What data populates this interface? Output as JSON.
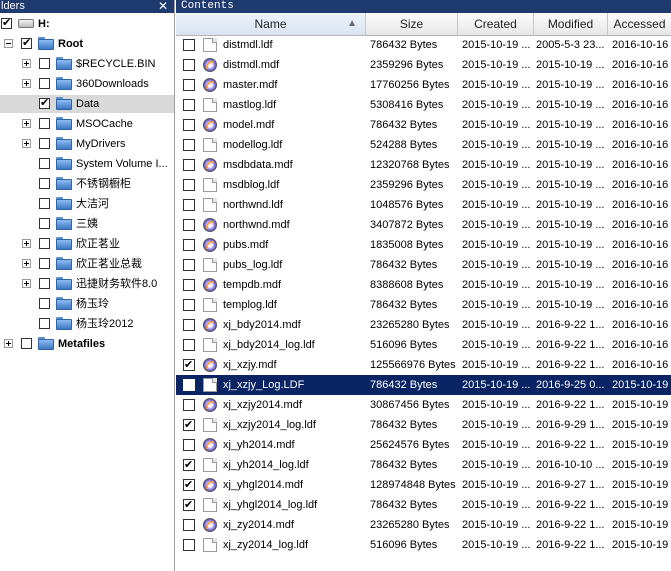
{
  "left_pane": {
    "title": "lders",
    "close_glyph": "✕",
    "tree": [
      {
        "label": "H:",
        "level": 0,
        "bold": true,
        "icon": "drive-icon",
        "checked": true,
        "expander": "none"
      },
      {
        "label": "Root",
        "level": 1,
        "bold": true,
        "icon": "folder-icon",
        "checked": true,
        "expander": "minus"
      },
      {
        "label": "$RECYCLE.BIN",
        "level": 2,
        "icon": "folder-icon",
        "checked": false,
        "expander": "plus"
      },
      {
        "label": "360Downloads",
        "level": 2,
        "icon": "folder-icon",
        "checked": false,
        "expander": "plus"
      },
      {
        "label": "Data",
        "level": 2,
        "icon": "folder-icon",
        "checked": true,
        "expander": "none",
        "selected": true
      },
      {
        "label": "MSOCache",
        "level": 2,
        "icon": "folder-icon",
        "checked": false,
        "expander": "plus"
      },
      {
        "label": "MyDrivers",
        "level": 2,
        "icon": "folder-icon",
        "checked": false,
        "expander": "plus"
      },
      {
        "label": "System Volume I...",
        "level": 2,
        "icon": "folder-icon",
        "checked": false,
        "expander": "none"
      },
      {
        "label": "不锈钢橱柜",
        "level": 2,
        "icon": "folder-icon",
        "checked": false,
        "expander": "none"
      },
      {
        "label": "大洁河",
        "level": 2,
        "icon": "folder-icon",
        "checked": false,
        "expander": "none"
      },
      {
        "label": "三姨",
        "level": 2,
        "icon": "folder-icon",
        "checked": false,
        "expander": "none"
      },
      {
        "label": "欣正茗业",
        "level": 2,
        "icon": "folder-icon",
        "checked": false,
        "expander": "plus"
      },
      {
        "label": "欣正茗业总裁",
        "level": 2,
        "icon": "folder-icon",
        "checked": false,
        "expander": "plus"
      },
      {
        "label": "迅捷财务软件8.0",
        "level": 2,
        "icon": "folder-icon",
        "checked": false,
        "expander": "plus"
      },
      {
        "label": "杨玉玲",
        "level": 2,
        "icon": "folder-icon",
        "checked": false,
        "expander": "none"
      },
      {
        "label": "杨玉玲2012",
        "level": 2,
        "icon": "folder-icon",
        "checked": false,
        "expander": "none"
      },
      {
        "label": "Metafiles",
        "level": 1,
        "bold": true,
        "icon": "folder-icon",
        "checked": false,
        "expander": "plus"
      }
    ]
  },
  "right_pane": {
    "title": "Contents",
    "columns": [
      "Name",
      "Size",
      "Created",
      "Modified",
      "Accessed"
    ],
    "sort_arrow": "▲",
    "files": [
      {
        "name": "distmdl.ldf",
        "size": "786432 Bytes",
        "created": "2015-10-19 ...",
        "modified": "2005-5-3 23...",
        "accessed": "2016-10-16",
        "icon": "doc",
        "checked": false
      },
      {
        "name": "distmdl.mdf",
        "size": "2359296 Bytes",
        "created": "2015-10-19 ...",
        "modified": "2015-10-19 ...",
        "accessed": "2016-10-16",
        "icon": "db",
        "checked": false
      },
      {
        "name": "master.mdf",
        "size": "17760256 Bytes",
        "created": "2015-10-19 ...",
        "modified": "2015-10-19 ...",
        "accessed": "2016-10-16",
        "icon": "db",
        "checked": false
      },
      {
        "name": "mastlog.ldf",
        "size": "5308416 Bytes",
        "created": "2015-10-19 ...",
        "modified": "2015-10-19 ...",
        "accessed": "2016-10-16",
        "icon": "doc",
        "checked": false
      },
      {
        "name": "model.mdf",
        "size": "786432 Bytes",
        "created": "2015-10-19 ...",
        "modified": "2015-10-19 ...",
        "accessed": "2016-10-16",
        "icon": "db",
        "checked": false
      },
      {
        "name": "modellog.ldf",
        "size": "524288 Bytes",
        "created": "2015-10-19 ...",
        "modified": "2015-10-19 ...",
        "accessed": "2016-10-16",
        "icon": "doc",
        "checked": false
      },
      {
        "name": "msdbdata.mdf",
        "size": "12320768 Bytes",
        "created": "2015-10-19 ...",
        "modified": "2015-10-19 ...",
        "accessed": "2016-10-16",
        "icon": "db",
        "checked": false
      },
      {
        "name": "msdblog.ldf",
        "size": "2359296 Bytes",
        "created": "2015-10-19 ...",
        "modified": "2015-10-19 ...",
        "accessed": "2016-10-16",
        "icon": "doc",
        "checked": false
      },
      {
        "name": "northwnd.ldf",
        "size": "1048576 Bytes",
        "created": "2015-10-19 ...",
        "modified": "2015-10-19 ...",
        "accessed": "2016-10-16",
        "icon": "doc",
        "checked": false
      },
      {
        "name": "northwnd.mdf",
        "size": "3407872 Bytes",
        "created": "2015-10-19 ...",
        "modified": "2015-10-19 ...",
        "accessed": "2016-10-16",
        "icon": "db",
        "checked": false
      },
      {
        "name": "pubs.mdf",
        "size": "1835008 Bytes",
        "created": "2015-10-19 ...",
        "modified": "2015-10-19 ...",
        "accessed": "2016-10-16",
        "icon": "db",
        "checked": false
      },
      {
        "name": "pubs_log.ldf",
        "size": "786432 Bytes",
        "created": "2015-10-19 ...",
        "modified": "2015-10-19 ...",
        "accessed": "2016-10-16",
        "icon": "doc",
        "checked": false
      },
      {
        "name": "tempdb.mdf",
        "size": "8388608 Bytes",
        "created": "2015-10-19 ...",
        "modified": "2015-10-19 ...",
        "accessed": "2016-10-16",
        "icon": "db",
        "checked": false
      },
      {
        "name": "templog.ldf",
        "size": "786432 Bytes",
        "created": "2015-10-19 ...",
        "modified": "2015-10-19 ...",
        "accessed": "2016-10-16",
        "icon": "doc",
        "checked": false
      },
      {
        "name": "xj_bdy2014.mdf",
        "size": "23265280 Bytes",
        "created": "2015-10-19 ...",
        "modified": "2016-9-22 1...",
        "accessed": "2016-10-16",
        "icon": "db",
        "checked": false
      },
      {
        "name": "xj_bdy2014_log.ldf",
        "size": "516096 Bytes",
        "created": "2015-10-19 ...",
        "modified": "2016-9-22 1...",
        "accessed": "2016-10-16",
        "icon": "doc",
        "checked": false
      },
      {
        "name": "xj_xzjy.mdf",
        "size": "125566976 Bytes",
        "created": "2015-10-19 ...",
        "modified": "2016-9-22 1...",
        "accessed": "2016-10-16",
        "icon": "db",
        "checked": true
      },
      {
        "name": "xj_xzjy_Log.LDF",
        "size": "786432 Bytes",
        "created": "2015-10-19 ...",
        "modified": "2016-9-25 0...",
        "accessed": "2015-10-19",
        "icon": "doc",
        "checked": false,
        "selected": true
      },
      {
        "name": "xj_xzjy2014.mdf",
        "size": "30867456 Bytes",
        "created": "2015-10-19 ...",
        "modified": "2016-9-22 1...",
        "accessed": "2015-10-19",
        "icon": "db",
        "checked": false
      },
      {
        "name": "xj_xzjy2014_log.ldf",
        "size": "786432 Bytes",
        "created": "2015-10-19 ...",
        "modified": "2016-9-29 1...",
        "accessed": "2015-10-19",
        "icon": "doc",
        "checked": true
      },
      {
        "name": "xj_yh2014.mdf",
        "size": "25624576 Bytes",
        "created": "2015-10-19 ...",
        "modified": "2016-9-22 1...",
        "accessed": "2015-10-19",
        "icon": "db",
        "checked": false
      },
      {
        "name": "xj_yh2014_log.ldf",
        "size": "786432 Bytes",
        "created": "2015-10-19 ...",
        "modified": "2016-10-10 ...",
        "accessed": "2015-10-19",
        "icon": "doc",
        "checked": true
      },
      {
        "name": "xj_yhgl2014.mdf",
        "size": "128974848 Bytes",
        "created": "2015-10-19 ...",
        "modified": "2016-9-27 1...",
        "accessed": "2015-10-19",
        "icon": "db",
        "checked": true
      },
      {
        "name": "xj_yhgl2014_log.ldf",
        "size": "786432 Bytes",
        "created": "2015-10-19 ...",
        "modified": "2016-9-22 1...",
        "accessed": "2015-10-19",
        "icon": "doc",
        "checked": true
      },
      {
        "name": "xj_zy2014.mdf",
        "size": "23265280 Bytes",
        "created": "2015-10-19 ...",
        "modified": "2016-9-22 1...",
        "accessed": "2015-10-19",
        "icon": "db",
        "checked": false
      },
      {
        "name": "xj_zy2014_log.ldf",
        "size": "516096 Bytes",
        "created": "2015-10-19 ...",
        "modified": "2016-9-22 1...",
        "accessed": "2015-10-19",
        "icon": "doc",
        "checked": false
      }
    ]
  },
  "colors": {
    "title_bar": "#1f3a6e",
    "selection": "#0b2463",
    "tree_selected": "#d9d9d9"
  }
}
